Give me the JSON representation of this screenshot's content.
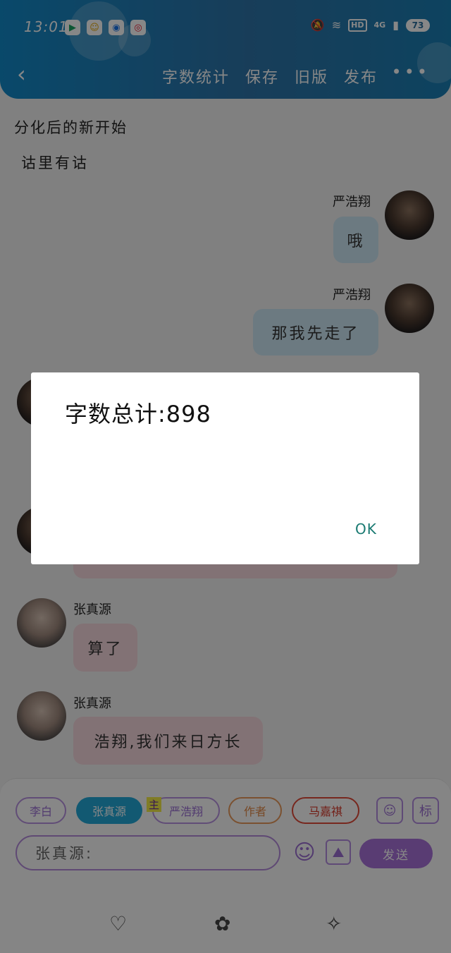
{
  "status_bar": {
    "time": "13:01",
    "battery": "73",
    "network": "4G",
    "hd": "HD"
  },
  "header": {
    "back_icon": "chevron-left-icon",
    "actions": [
      "字数统计",
      "保存",
      "旧版",
      "发布"
    ],
    "more": "•••"
  },
  "story": {
    "title": "分化后的新开始",
    "subtitle": "诂里有诂"
  },
  "messages": [
    {
      "speaker": "严浩翔",
      "text": "哦",
      "side": "right"
    },
    {
      "speaker": "严浩翔",
      "text": "那我先走了",
      "side": "right"
    },
    {
      "speaker": "张真源",
      "text": "算了",
      "side": "left"
    },
    {
      "speaker": "张真源",
      "text": "浩翔,我们来日方长",
      "side": "left"
    }
  ],
  "composer": {
    "characters": [
      "李白",
      "张真源",
      "严浩翔",
      "作者",
      "马嘉祺"
    ],
    "main_tag": "主",
    "biao_button": "标",
    "input_value": "张真源:",
    "send_label": "发送"
  },
  "bottom_nav": [
    "heart-icon",
    "flower-icon",
    "sparkle-icon"
  ],
  "dialog": {
    "text": "字数总计:898",
    "ok_label": "OK"
  },
  "colors": {
    "header_gradient": "#128ac9",
    "bubble_blue": "#cde6f3",
    "bubble_pink": "#f6d8dd",
    "accent_purple": "#a872d9",
    "ok_teal": "#1a7a72"
  }
}
